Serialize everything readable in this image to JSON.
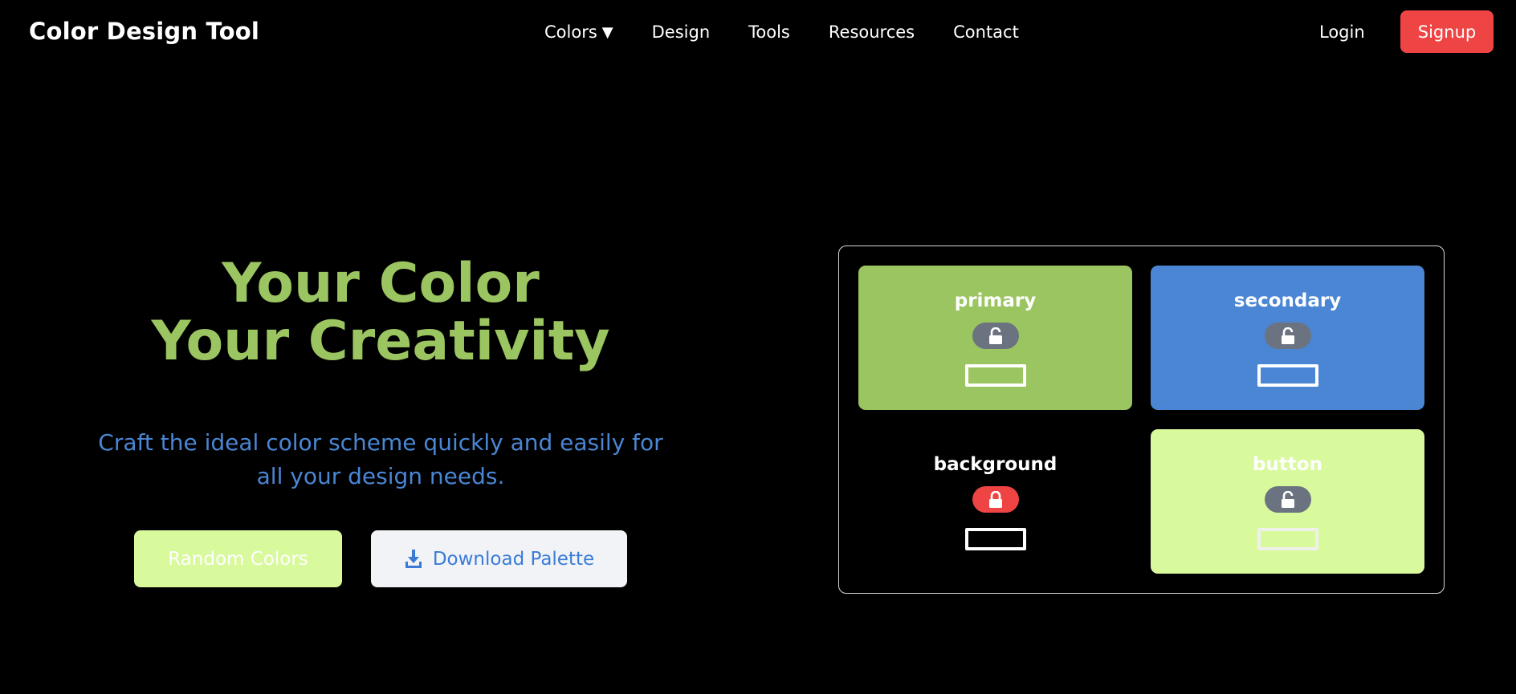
{
  "navbar": {
    "brand": "Color Design Tool",
    "items": [
      {
        "label": "Colors",
        "has_dropdown": true,
        "caret": "▼"
      },
      {
        "label": "Design"
      },
      {
        "label": "Tools"
      },
      {
        "label": "Resources"
      },
      {
        "label": "Contact"
      }
    ],
    "login_label": "Login",
    "signup_label": "Signup"
  },
  "hero": {
    "title_line1": "Your Color",
    "title_line2": "Your Creativity",
    "subtitle": "Craft the ideal color scheme quickly and easily for all your design needs.",
    "random_button_label": "Random Colors",
    "download_button_label": "Download Palette"
  },
  "palette": {
    "swatches": [
      {
        "label": "primary",
        "color": "#9bc561",
        "locked": false,
        "lock_icon": "unlock-icon"
      },
      {
        "label": "secondary",
        "color": "#4a86d4",
        "locked": false,
        "lock_icon": "unlock-icon"
      },
      {
        "label": "background",
        "color": "#000000",
        "locked": true,
        "lock_icon": "lock-icon"
      },
      {
        "label": "button",
        "color": "#d9f99d",
        "locked": false,
        "lock_icon": "unlock-icon"
      }
    ]
  },
  "colors": {
    "accent_green": "#9bc561",
    "accent_blue": "#4a86d4",
    "signup_red": "#ef4444",
    "lock_gray": "#6b7280",
    "lock_red": "#ef4444"
  }
}
